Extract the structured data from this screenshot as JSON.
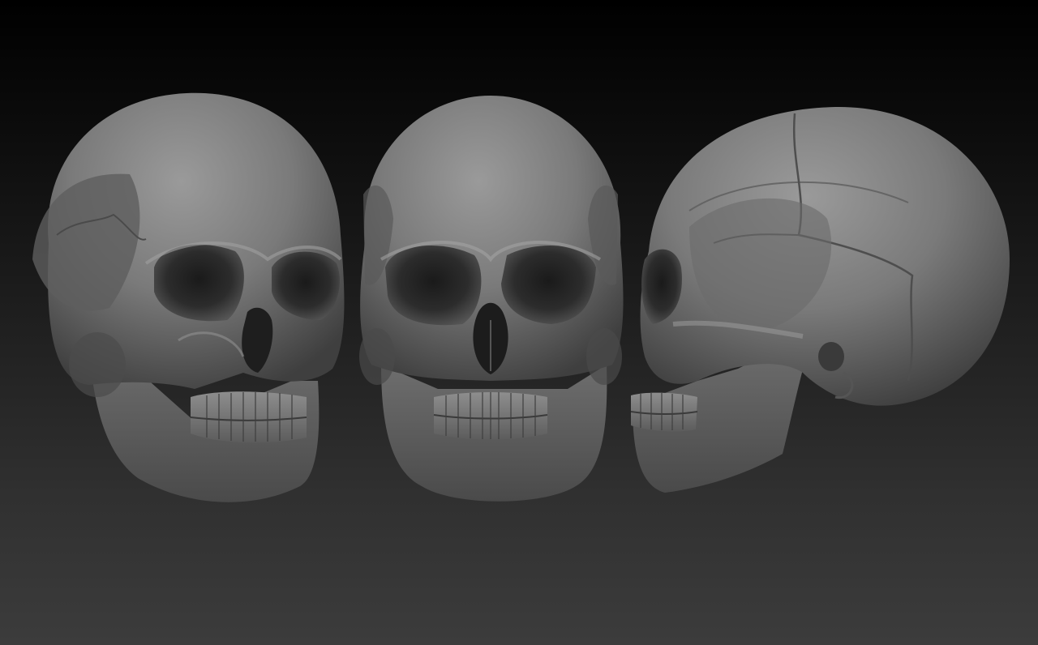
{
  "scene": {
    "background_top": "#000000",
    "background_bottom": "#3c3c3c",
    "material_color": "#8a8a8a",
    "views": [
      {
        "id": "skull-three-quarter-view"
      },
      {
        "id": "skull-front-view"
      },
      {
        "id": "skull-side-view"
      }
    ]
  }
}
